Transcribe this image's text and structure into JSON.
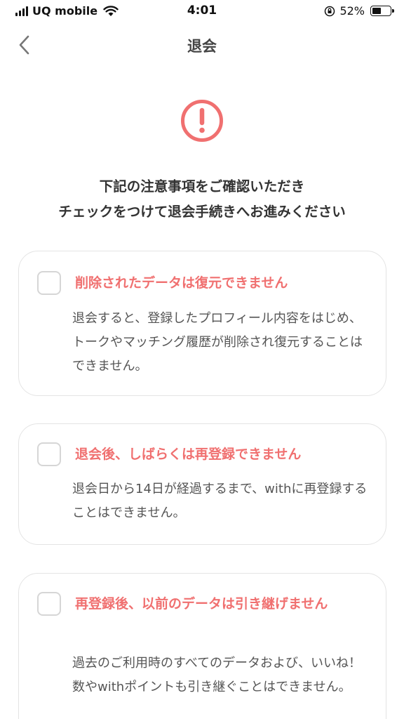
{
  "status_bar": {
    "carrier": "UQ mobile",
    "time": "4:01",
    "battery_percent": "52%",
    "battery_level": 0.52,
    "icons": [
      "signal-icon",
      "wifi-icon",
      "orientation-lock-icon",
      "battery-icon"
    ]
  },
  "nav": {
    "title": "退会",
    "back_icon": "chevron-left-icon"
  },
  "warning": {
    "icon": "exclamation-circle-icon",
    "color": "#f07070"
  },
  "notice": {
    "line1": "下記の注意事項をご確認いただき",
    "line2": "チェックをつけて退会手続きへお進みください"
  },
  "cards": [
    {
      "title": "削除されたデータは復元できません",
      "body": "退会すると、登録したプロフィール内容をはじめ、トークやマッチング履歴が削除され復元することはできません。",
      "checked": false
    },
    {
      "title": "退会後、しばらくは再登録できません",
      "body": "退会日から14日が経過するまで、withに再登録することはできません。",
      "checked": false
    },
    {
      "title": "再登録後、以前のデータは引き継げません",
      "body": "過去のご利用時のすべてのデータおよび、いいね！数やwithポイントも引き継ぐことはできません。",
      "checked": false
    }
  ],
  "colors": {
    "accent": "#f07070",
    "text": "#333333",
    "card_border": "#e4e4e4"
  }
}
